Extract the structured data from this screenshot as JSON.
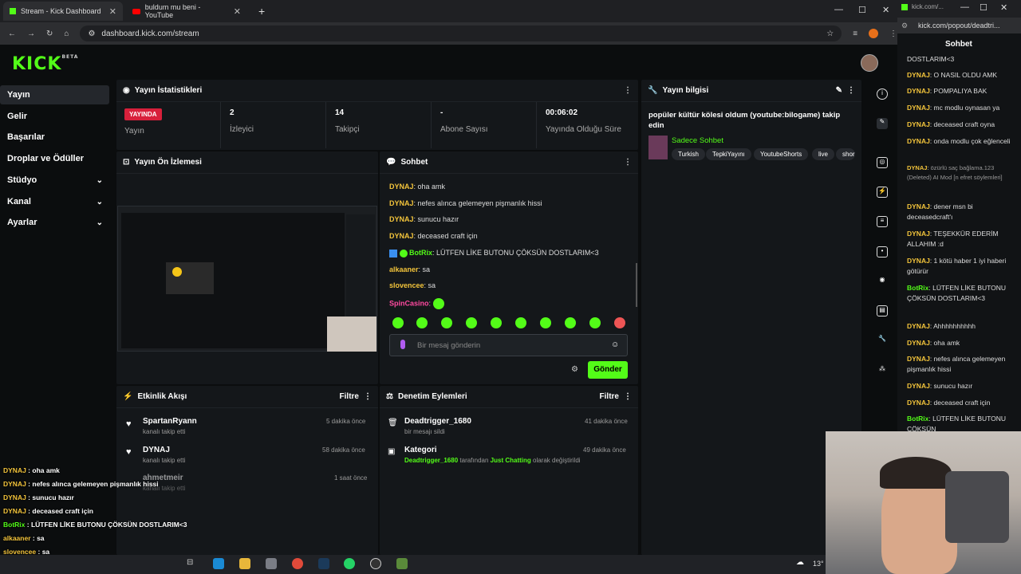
{
  "browser": {
    "tabs": [
      {
        "title": "Stream - Kick Dashboard",
        "active": true
      },
      {
        "title": "buldum mu beni - YouTube",
        "active": false
      }
    ],
    "url": "dashboard.kick.com/stream",
    "popout_tab": "kick.com/...",
    "popout_url": "kick.com/popout/deadtri..."
  },
  "logo": {
    "text": "KICK",
    "sup": "BETA"
  },
  "sidebar": {
    "items": [
      {
        "label": "Yayın",
        "active": true
      },
      {
        "label": "Gelir"
      },
      {
        "label": "Başarılar"
      },
      {
        "label": "Droplar ve Ödüller"
      },
      {
        "label": "Stüdyo",
        "expandable": true
      },
      {
        "label": "Kanal",
        "expandable": true
      },
      {
        "label": "Ayarlar",
        "expandable": true
      }
    ]
  },
  "stats": {
    "title": "Yayın İstatistikleri",
    "live_badge": "YAYINDA",
    "live_label": "Yayın",
    "viewers": "2",
    "viewers_label": "İzleyici",
    "followers": "14",
    "followers_label": "Takipçi",
    "subs": "-",
    "subs_label": "Abone Sayısı",
    "uptime": "00:06:02",
    "uptime_label": "Yayında Olduğu Süre"
  },
  "info": {
    "title": "Yayın bilgisi",
    "stream_title": "popüler kültür kölesi oldum (youtube:bilogame) takip edin",
    "category": "Sadece Sohbet",
    "tags": [
      "Turkish",
      "TepkiYayını",
      "YoutubeShorts",
      "live",
      "shor"
    ]
  },
  "preview": {
    "title": "Yayın Ön İzlemesi"
  },
  "chat": {
    "title": "Sohbet",
    "messages": [
      {
        "user": "DYNAJ",
        "text": "oha amk"
      },
      {
        "user": "DYNAJ",
        "text": "nefes alınca gelemeyen pişmanlık hissi"
      },
      {
        "user": "DYNAJ",
        "text": "sunucu hazır"
      },
      {
        "user": "DYNAJ",
        "text": "deceased craft için"
      },
      {
        "user": "BotRix",
        "text": "LÜTFEN LİKE BUTONU ÇÖKSÜN DOSTLARIM<3"
      },
      {
        "user": "alkaaner",
        "text": "sa"
      },
      {
        "user": "slovencee",
        "text": "sa"
      },
      {
        "user": "SpinCasino",
        "text": ""
      }
    ],
    "placeholder": "Bir mesaj gönderin",
    "send": "Gönder"
  },
  "activity": {
    "title": "Etkinlik Akışı",
    "filter": "Filtre",
    "events": [
      {
        "name": "SpartanRyann",
        "desc": "kanalı takip etti",
        "time": "5 dakika önce"
      },
      {
        "name": "DYNAJ",
        "desc": "kanalı takip etti",
        "time": "58 dakika önce"
      },
      {
        "name": "ahmetmeir",
        "desc": "kanalı takip etti",
        "time": "1 saat önce"
      }
    ]
  },
  "moderation": {
    "title": "Denetim Eylemleri",
    "filter": "Filtre",
    "actions": [
      {
        "name": "Deadtrigger_1680",
        "desc": "bir mesajı sildi",
        "time": "41 dakika önce"
      },
      {
        "name": "Kategori",
        "desc_user": "Deadtrigger_1680",
        "desc_mid": "tarafından",
        "desc_cat": "Just Chatting",
        "desc_end": "olarak değiştirildi",
        "time": "49 dakika önce"
      }
    ]
  },
  "popout": {
    "title": "Sohbet",
    "lines": [
      {
        "user": "",
        "text": "DOSTLARIM<3"
      },
      {
        "user": "DYNAJ",
        "text": "O NASIL OLDU AMK"
      },
      {
        "user": "DYNAJ",
        "text": "POMPALIYA BAK"
      },
      {
        "user": "DYNAJ",
        "text": "mc modlu oynasan ya"
      },
      {
        "user": "DYNAJ",
        "text": "deceased craft oyna"
      },
      {
        "user": "DYNAJ",
        "text": "onda modlu çok eğlenceli"
      },
      {
        "user": "DYNAJ",
        "text": "özürlü saç bağlama.123 (Deleted) AI Mod [n efret söylemleri]"
      },
      {
        "user": "DYNAJ",
        "text": "dener msn bi deceasedcraft'ı"
      },
      {
        "user": "DYNAJ",
        "text": "TEŞEKKÜR EDERİM ALLAHIM :d"
      },
      {
        "user": "DYNAJ",
        "text": "1 kötü haber 1 iyi haberi götürür"
      },
      {
        "user": "BotRix",
        "text": "LÜTFEN LİKE BUTONU ÇÖKSÜN DOSTLARIM<3"
      },
      {
        "user": "DYNAJ",
        "text": "Ahhhhhhhhhh"
      },
      {
        "user": "DYNAJ",
        "text": "oha amk"
      },
      {
        "user": "DYNAJ",
        "text": "nefes alınca gelemeyen pişmanlık hissi"
      },
      {
        "user": "DYNAJ",
        "text": "sunucu hazır"
      },
      {
        "user": "DYNAJ",
        "text": "deceased craft için"
      },
      {
        "user": "BotRix",
        "text": "LÜTFEN LİKE BUTONU ÇÖKSÜN"
      }
    ]
  },
  "overlay": {
    "lines": [
      {
        "user": "DYNAJ",
        "text": "oha amk"
      },
      {
        "user": "DYNAJ",
        "text": "nefes alınca gelemeyen pişmanlık hissi"
      },
      {
        "user": "DYNAJ",
        "text": "sunucu hazır"
      },
      {
        "user": "DYNAJ",
        "text": "deceased craft için"
      },
      {
        "user": "BotRix",
        "text": "LÜTFEN LİKE BUTONU ÇÖKSÜN DOSTLARIM<3"
      },
      {
        "user": "alkaaner",
        "text": "sa"
      },
      {
        "user": "slovencee",
        "text": "sa"
      }
    ]
  },
  "taskbar": {
    "temp": "13°"
  }
}
